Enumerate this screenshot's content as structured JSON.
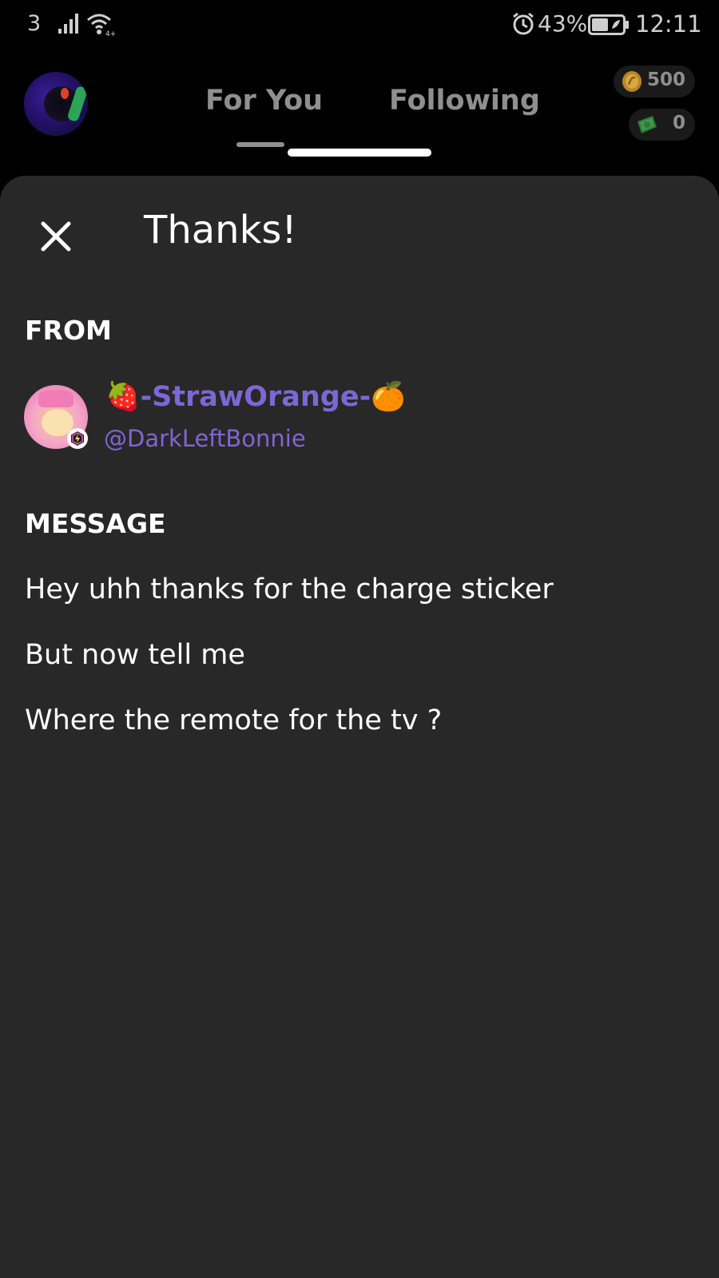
{
  "status_bar": {
    "carrier": "3",
    "battery_percent": "43%",
    "time": "12:11",
    "icons": [
      "signal-icon",
      "wifi-icon",
      "alarm-icon",
      "battery-icon"
    ]
  },
  "header": {
    "tabs": [
      {
        "label": "For You",
        "active": true
      },
      {
        "label": "Following",
        "active": false
      }
    ],
    "currencies": [
      {
        "icon": "coin-icon",
        "value": "500"
      },
      {
        "icon": "cash-icon",
        "value": "0"
      }
    ]
  },
  "sheet": {
    "title": "Thanks!",
    "close_icon": "close-icon",
    "from_label": "FROM",
    "sender": {
      "display_name": "🍓-StrawOrange-🍊",
      "handle": "@DarkLeftBonnie"
    },
    "message_label": "MESSAGE",
    "message_lines": [
      "Hey uhh thanks for the charge sticker",
      "But now tell me",
      "Where the remote for the tv ?"
    ]
  },
  "colors": {
    "background": "#000000",
    "sheet": "#282828",
    "accent_purple": "#7d67d4",
    "muted_text": "#8f8f8f"
  }
}
